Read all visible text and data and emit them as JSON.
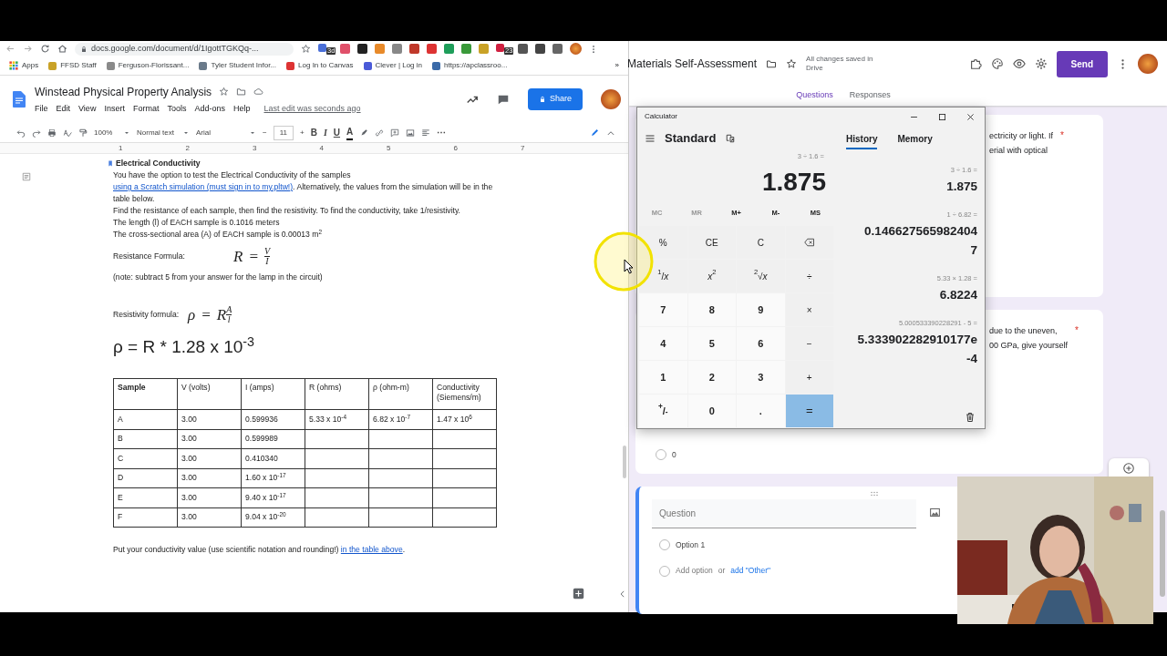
{
  "browser": {
    "url": "docs.google.com/document/d/1IgottTGKQq-...",
    "extension_badges": [
      "3d",
      "23"
    ],
    "bookmarks": [
      {
        "label": "Apps",
        "kind": "apps"
      },
      {
        "label": "FFSD Staff",
        "kind": "site"
      },
      {
        "label": "Ferguson-Florissant...",
        "kind": "site"
      },
      {
        "label": "Tyler Student Infor...",
        "kind": "site"
      },
      {
        "label": "Log In to Canvas",
        "kind": "site"
      },
      {
        "label": "Clever | Log in",
        "kind": "site"
      },
      {
        "label": "https://apclassroo...",
        "kind": "site"
      }
    ],
    "bookmarks_more": "»"
  },
  "docs": {
    "title": "Winstead Physical Property Analysis",
    "menu": [
      "File",
      "Edit",
      "View",
      "Insert",
      "Format",
      "Tools",
      "Add-ons",
      "Help"
    ],
    "last_edit": "Last edit was seconds ago",
    "share": "Share",
    "toolbar": {
      "zoom": "100%",
      "style": "Normal text",
      "font": "Arial",
      "size_minus": "−",
      "size": "11",
      "size_plus": "+",
      "format_buttons": [
        "B",
        "I",
        "U",
        "A"
      ],
      "more": "⋯"
    },
    "ruler": [
      "1",
      "2",
      "3",
      "4",
      "5",
      "6",
      "7"
    ],
    "heading": "Electrical Conductivity",
    "intro": {
      "before": "You have the option to test the Electrical Conductivity of the samples ",
      "link": "using a Scratch simulation (must sign in to my.pltw!)",
      "after": ". Alternatively, the values from the simulation will be in the table below."
    },
    "lines": [
      "Find the resistance of each sample, then find the resistivity. To find the conductivity, take 1/resistivity.",
      "The length (l) of EACH sample is 0.1016 meters",
      "The cross-sectional area (A) of EACH sample is 0.00013 m$^{2}$"
    ],
    "resistance": {
      "label": "Resistance Formula:",
      "lhs": "R",
      "eq": "=",
      "num": "V",
      "den": "I"
    },
    "note": "(note: subtract 5 from your answer for the lamp in the circuit)",
    "resistivity": {
      "label": "Resistivity formula:",
      "lhs": "ρ",
      "eq": "=",
      "factor": "R",
      "num": "A",
      "den": "l"
    },
    "big_formula": "ρ = R * 1.28 x 10$^{-3}$",
    "table": {
      "columns": [
        "Sample",
        "V (volts)",
        "I (amps)",
        "R (ohms)",
        "ρ (ohm-m)",
        "Conductivity (Siemens/m)"
      ],
      "rows": [
        [
          "A",
          "3.00",
          "0.599936",
          "5.33 x 10$^{-4}$",
          "6.82 x 10$^{-7}$",
          "1.47 x 10$^{6}$"
        ],
        [
          "B",
          "3.00",
          "0.599989",
          "",
          "",
          ""
        ],
        [
          "C",
          "3.00",
          "0.410340",
          "",
          "",
          ""
        ],
        [
          "D",
          "3.00",
          "1.60 x 10$^{-17}$",
          "",
          "",
          ""
        ],
        [
          "E",
          "3.00",
          "9.40 x 10$^{-17}$",
          "",
          "",
          ""
        ],
        [
          "F",
          "3.00",
          "9.04 x 10$^{-20}$",
          "",
          "",
          ""
        ]
      ]
    },
    "footer": {
      "before": "Put your conductivity value (use scientific notation and rounding!) ",
      "link": "in the table above",
      "after": "."
    }
  },
  "forms": {
    "title": "Materials Self-Assessment",
    "save_status": "All changes saved in Drive",
    "send": "Send",
    "tabs": [
      {
        "label": "Questions",
        "selected": true
      },
      {
        "label": "Responses",
        "selected": false
      }
    ],
    "cards": [
      {
        "kind": "question",
        "lines": [
          "ectricity or light. If",
          "erial with optical"
        ],
        "required": "*"
      },
      {
        "kind": "question",
        "lines": [
          "due to the uneven,",
          "00 GPa, give yourself"
        ],
        "required": "*",
        "options": [
          {
            "label": "0",
            "selected": false
          }
        ]
      },
      {
        "kind": "new",
        "placeholder": "Question",
        "options": [
          {
            "label": "Option 1",
            "selected": false
          }
        ],
        "add_option": "Add option",
        "or": "or",
        "add_other": "add \"Other\""
      }
    ]
  },
  "calculator": {
    "title": "Calculator",
    "mode": "Standard",
    "panel_tabs": [
      {
        "label": "History",
        "selected": true
      },
      {
        "label": "Memory",
        "selected": false
      }
    ],
    "expression": "3 ÷ 1.6 =",
    "display": "1.875",
    "memory": [
      {
        "label": "MC",
        "disabled": true
      },
      {
        "label": "MR",
        "disabled": true
      },
      {
        "label": "M+",
        "disabled": false
      },
      {
        "label": "M-",
        "disabled": false
      },
      {
        "label": "MS",
        "disabled": false
      }
    ],
    "keys": [
      {
        "label": "%",
        "kind": "op"
      },
      {
        "label": "CE",
        "kind": "op"
      },
      {
        "label": "C",
        "kind": "op"
      },
      {
        "kind": "backspace"
      },
      {
        "label": "$^{1}$/*x*",
        "kind": "op"
      },
      {
        "label": "*x*$^{2}$",
        "kind": "op"
      },
      {
        "label": "$^{2}$√*x*",
        "kind": "op"
      },
      {
        "label": "÷",
        "kind": "op"
      },
      {
        "label": "7",
        "kind": "digit"
      },
      {
        "label": "8",
        "kind": "digit"
      },
      {
        "label": "9",
        "kind": "digit"
      },
      {
        "label": "×",
        "kind": "op"
      },
      {
        "label": "4",
        "kind": "digit"
      },
      {
        "label": "5",
        "kind": "digit"
      },
      {
        "label": "6",
        "kind": "digit"
      },
      {
        "label": "−",
        "kind": "op"
      },
      {
        "label": "1",
        "kind": "digit"
      },
      {
        "label": "2",
        "kind": "digit"
      },
      {
        "label": "3",
        "kind": "digit"
      },
      {
        "label": "+",
        "kind": "op"
      },
      {
        "label": "$^{+}$/$_{-}$",
        "kind": "digit"
      },
      {
        "label": "0",
        "kind": "digit"
      },
      {
        "label": ".",
        "kind": "digit"
      },
      {
        "label": "=",
        "kind": "equals"
      }
    ],
    "history": [
      {
        "expr": "3 ÷ 1.6 =",
        "result_lines": [
          "1.875"
        ]
      },
      {
        "expr": "1 ÷ 6.82 =",
        "result_lines": [
          "0.146627565982404",
          "7"
        ]
      },
      {
        "expr": "5.33 × 1.28 =",
        "result_lines": [
          "6.8224"
        ]
      },
      {
        "expr": "5.000533390228291 - 5 =",
        "result_lines": [
          "5.333902282910177e",
          "-4"
        ]
      }
    ]
  }
}
